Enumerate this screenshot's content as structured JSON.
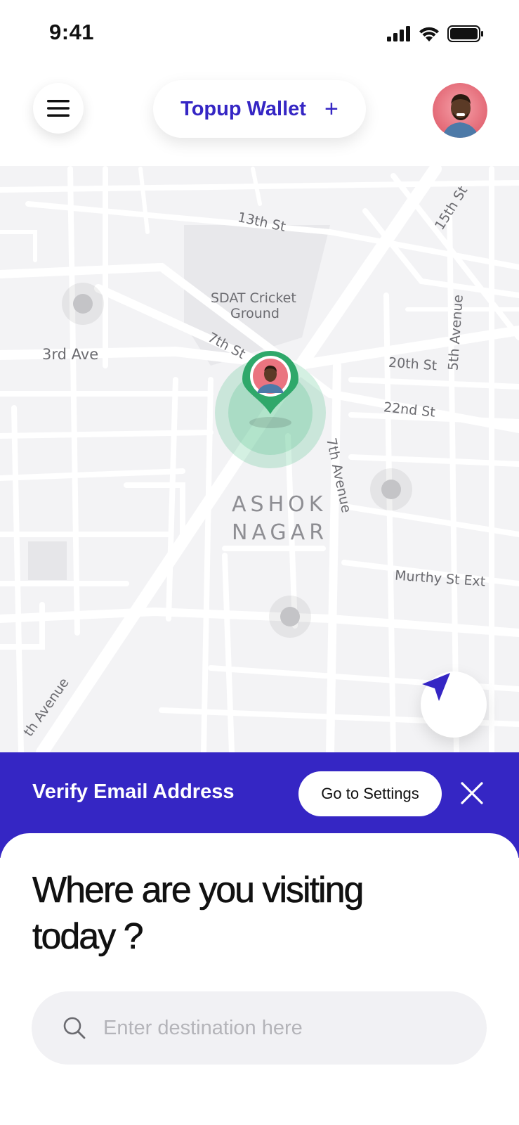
{
  "status_bar": {
    "time": "9:41"
  },
  "header": {
    "wallet_label": "Topup Wallet",
    "wallet_plus": "+"
  },
  "map": {
    "streets": [
      "13th St",
      "15th St",
      "SDAT Cricket",
      "Ground",
      "3rd Ave",
      "7th St",
      "20th St",
      "5th Avenue",
      "22nd St",
      "7th Avenue",
      "Murthy St Ext",
      "th Avenue"
    ],
    "area_line1": "ASHOK",
    "area_line2": "NAGAR"
  },
  "banner": {
    "text": "Verify Email Address",
    "button": "Go to Settings"
  },
  "sheet": {
    "title": "Where are you visiting today ?",
    "search_placeholder": "Enter destination here"
  },
  "colors": {
    "brand": "#3526c4",
    "pin": "#2fa86a",
    "map_bg": "#f3f3f5"
  }
}
